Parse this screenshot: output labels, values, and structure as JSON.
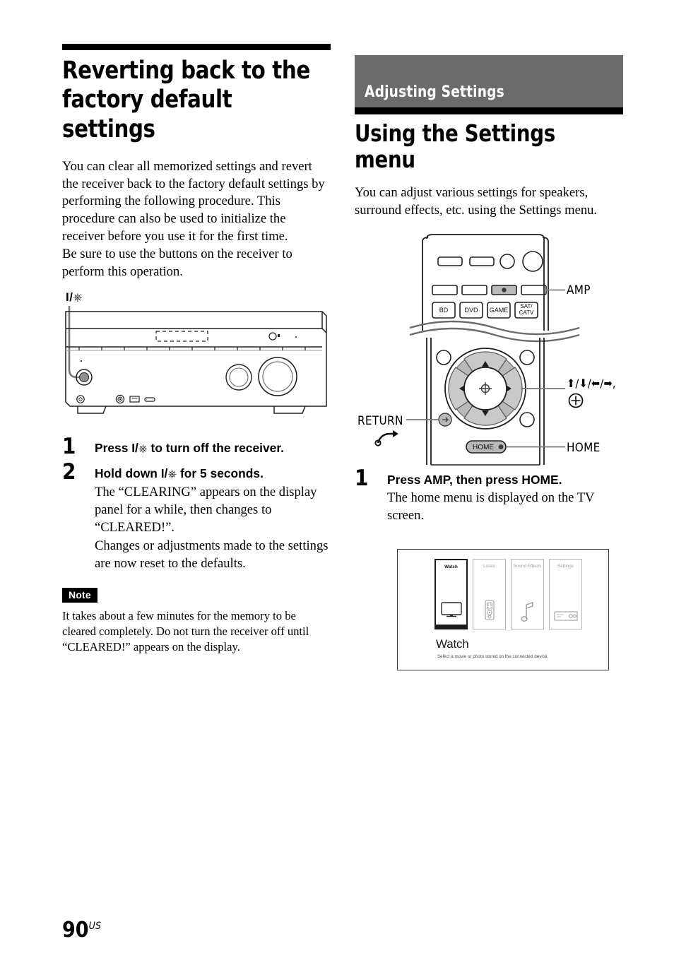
{
  "left_column": {
    "heading": "Reverting back to the factory default settings",
    "intro_paragraph_1": "You can clear all memorized settings and revert the receiver back to the factory default settings by performing the following procedure. This procedure can also be used to initialize the receiver before you use it for the first time.",
    "intro_paragraph_2": "Be sure to use the buttons on the receiver to perform this operation.",
    "receiver_figure": {
      "callout_power": "I/⏻"
    },
    "steps": [
      {
        "number": "1",
        "heading_prefix": "Press ",
        "heading_symbol": "I/⏻",
        "heading_suffix": " to turn off the receiver.",
        "body": ""
      },
      {
        "number": "2",
        "heading_prefix": "Hold down ",
        "heading_symbol": "I/⏻",
        "heading_suffix": " for 5 seconds.",
        "body_line_1": "The “CLEARING” appears on the display panel for a while, then changes to “CLEARED!”.",
        "body_line_2": "Changes or adjustments made to the settings are now reset to the defaults."
      }
    ],
    "note": {
      "tag": "Note",
      "text": "It takes about a few minutes for the memory to be cleared completely. Do not turn the receiver off until “CLEARED!” appears on the display."
    }
  },
  "right_column": {
    "section_band": "Adjusting Settings",
    "section_title": "Using the Settings menu",
    "intro_paragraph": "You can adjust various settings for speakers, surround effects, etc. using the Settings menu.",
    "remote_figure": {
      "input_buttons": [
        "BD",
        "DVD",
        "GAME",
        "SAT/\nCATV"
      ],
      "input_button_labels": [
        "BD",
        "DVD",
        "GAME",
        "SAT/",
        "CATV"
      ],
      "home_button": "HOME",
      "callouts": {
        "amp": "AMP",
        "return": "RETURN",
        "cursor": "⬆/⬇/⬅/➡,",
        "enter": "⊕",
        "home": "HOME"
      }
    },
    "steps": [
      {
        "number": "1",
        "heading": "Press AMP, then press HOME.",
        "body": "The home menu is displayed on the TV screen."
      }
    ],
    "tv_screen": {
      "columns": [
        {
          "label": "Watch",
          "icon": "tv-icon",
          "selected": true
        },
        {
          "label": "Listen",
          "icon": "remote-icon",
          "selected": false
        },
        {
          "label": "Sound Effects",
          "icon": "music-note-icon",
          "selected": false
        },
        {
          "label": "Settings",
          "icon": "receiver-icon",
          "selected": false
        }
      ],
      "selected_title": "Watch",
      "selected_description": "Select a movie or photo stored on the connected device."
    }
  },
  "footer": {
    "page_number": "90",
    "page_suffix": "US"
  },
  "colors": {
    "band_gray": "#6b6b6b",
    "rule_black": "#000000",
    "line_gray": "#555555",
    "highlight_gray": "#b9b9b9"
  }
}
